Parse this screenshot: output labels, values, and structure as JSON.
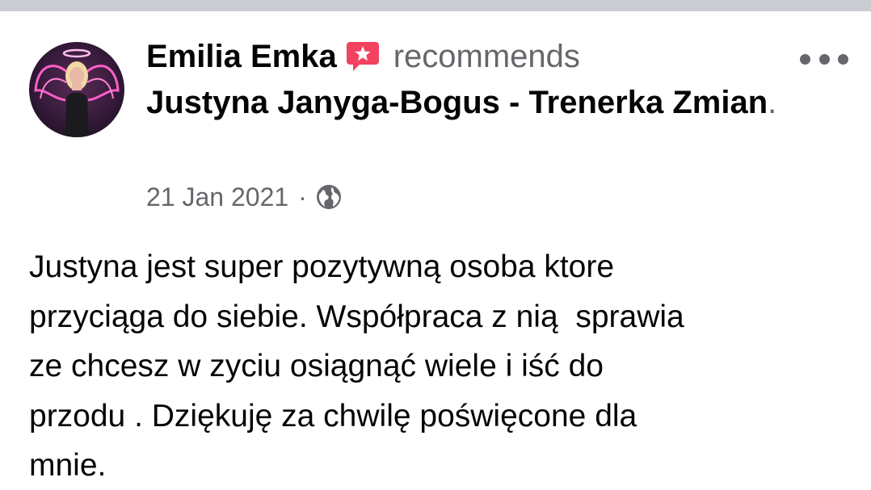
{
  "post": {
    "author": "Emilia Emka",
    "action": "recommends",
    "page_name": "Justyna Janyga-Bogus - Trenerka Zmian",
    "period": ".",
    "date": "21 Jan 2021",
    "separator": "·",
    "privacy_icon": "globe-icon",
    "recommend_icon": "recommendation-star-icon",
    "more_icon": "more-options-icon",
    "text": "Justyna jest super pozytywną osoba ktore\nprzyciąga do siebie. Współpraca z nią  sprawia\nze chcesz w zyciu osiągnąć wiele i iść do\nprzodu . Dziękuję za chwilę poświęcone dla\nmnie."
  },
  "colors": {
    "primary_text": "#050505",
    "secondary_text": "#65676b",
    "recommend_badge": "#f3425f",
    "divider": "#c9ccd1"
  }
}
